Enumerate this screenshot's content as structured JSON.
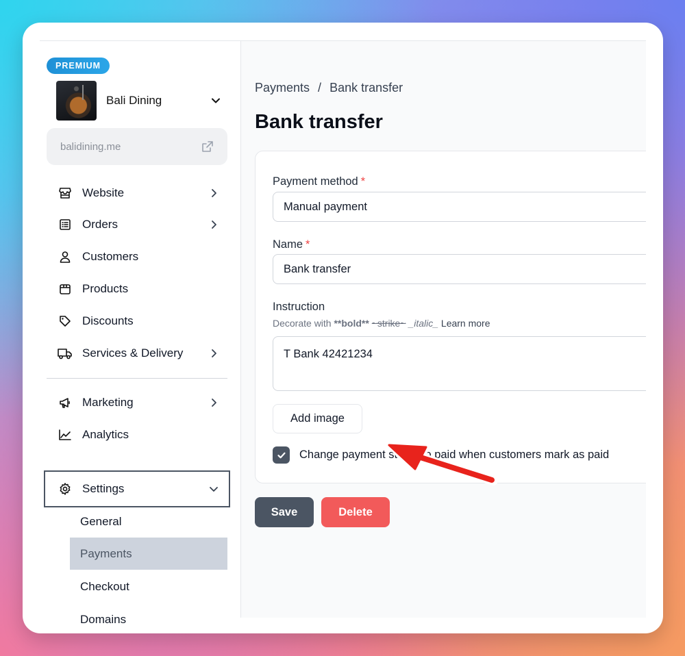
{
  "sidebar": {
    "badge": "PREMIUM",
    "store_name": "Bali Dining",
    "domain": "balidining.me",
    "nav": [
      {
        "label": "Website",
        "icon": "storefront-icon",
        "has_chevron": true
      },
      {
        "label": "Orders",
        "icon": "receipt-icon",
        "has_chevron": true
      },
      {
        "label": "Customers",
        "icon": "user-icon",
        "has_chevron": false
      },
      {
        "label": "Products",
        "icon": "box-icon",
        "has_chevron": false
      },
      {
        "label": "Discounts",
        "icon": "tag-icon",
        "has_chevron": false
      },
      {
        "label": "Services & Delivery",
        "icon": "truck-icon",
        "has_chevron": true
      },
      {
        "label": "Marketing",
        "icon": "megaphone-icon",
        "has_chevron": true
      },
      {
        "label": "Analytics",
        "icon": "chart-line-icon",
        "has_chevron": false
      }
    ],
    "settings": {
      "label": "Settings",
      "icon": "gear-icon",
      "sub": [
        "General",
        "Payments",
        "Checkout",
        "Domains"
      ],
      "active_sub": "Payments"
    }
  },
  "main": {
    "breadcrumb": [
      "Payments",
      "Bank transfer"
    ],
    "breadcrumb_sep": "/",
    "title": "Bank transfer",
    "form": {
      "payment_method_label": "Payment method",
      "payment_method_value": "Manual payment",
      "name_label": "Name",
      "name_value": "Bank transfer",
      "required_mark": "*",
      "instruction_label": "Instruction",
      "hint_prefix": "Decorate with",
      "hint_bold": "**bold**",
      "hint_strike": "~strike~",
      "hint_italic": "_italic_",
      "hint_link": "Learn more",
      "instruction_value": "T Bank 42421234",
      "add_image_label": "Add image",
      "checkbox_label": "Change payment status to paid when customers mark as paid",
      "checkbox_checked": true
    },
    "save_label": "Save",
    "delete_label": "Delete"
  },
  "colors": {
    "accent_dark": "#4b5563",
    "danger": "#f25a5a",
    "premium": "#2ba6e8",
    "annotation_arrow": "#e8231c"
  }
}
